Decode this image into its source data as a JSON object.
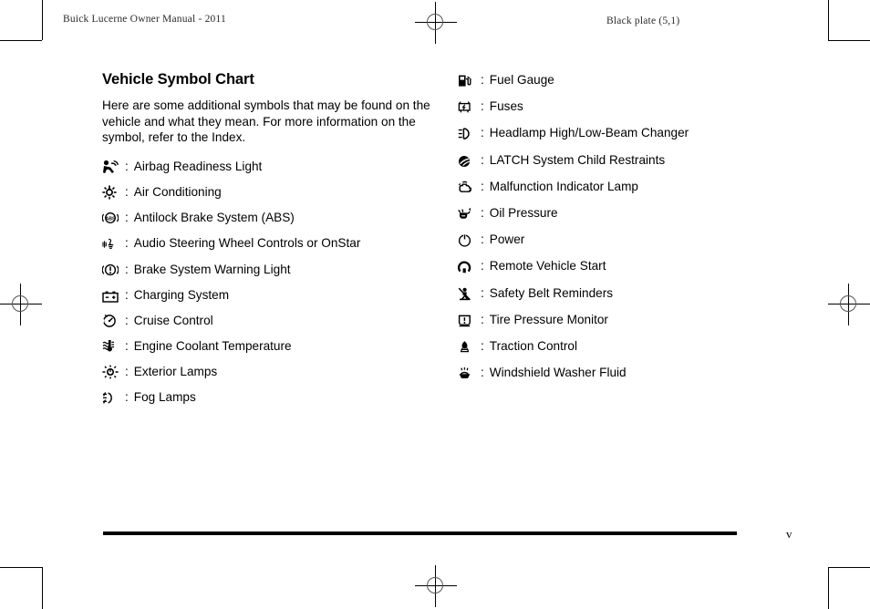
{
  "header": {
    "left_text": "Buick Lucerne Owner Manual - 2011",
    "right_text": "Black plate (5,1)"
  },
  "main": {
    "title": "Vehicle Symbol Chart",
    "intro": "Here are some additional symbols that may be found on the vehicle and what they mean. For more information on the symbol, refer to the Index.",
    "separator": ":",
    "left_column": [
      {
        "icon": "airbag-readiness-icon",
        "label": "Airbag Readiness Light"
      },
      {
        "icon": "air-conditioning-icon",
        "label": "Air Conditioning"
      },
      {
        "icon": "abs-icon",
        "label": "Antilock Brake System (ABS)"
      },
      {
        "icon": "audio-steering-icon",
        "label": "Audio Steering Wheel Controls or OnStar",
        "superscript": "®"
      },
      {
        "icon": "brake-warning-icon",
        "label": "Brake System Warning Light"
      },
      {
        "icon": "charging-system-icon",
        "label": "Charging System"
      },
      {
        "icon": "cruise-control-icon",
        "label": "Cruise Control"
      },
      {
        "icon": "engine-coolant-temp-icon",
        "label": "Engine Coolant Temperature"
      },
      {
        "icon": "exterior-lamps-icon",
        "label": "Exterior Lamps"
      },
      {
        "icon": "fog-lamps-icon",
        "label": "Fog Lamps"
      }
    ],
    "right_column": [
      {
        "icon": "fuel-gauge-icon",
        "label": "Fuel Gauge"
      },
      {
        "icon": "fuses-icon",
        "label": "Fuses"
      },
      {
        "icon": "headlamp-beam-icon",
        "label": "Headlamp High/Low-Beam Changer"
      },
      {
        "icon": "latch-child-restraint-icon",
        "label": "LATCH System Child Restraints"
      },
      {
        "icon": "malfunction-indicator-icon",
        "label": "Malfunction Indicator Lamp"
      },
      {
        "icon": "oil-pressure-icon",
        "label": "Oil Pressure"
      },
      {
        "icon": "power-icon",
        "label": "Power"
      },
      {
        "icon": "remote-vehicle-start-icon",
        "label": "Remote Vehicle Start"
      },
      {
        "icon": "safety-belt-icon",
        "label": "Safety Belt Reminders"
      },
      {
        "icon": "tire-pressure-icon",
        "label": "Tire Pressure Monitor"
      },
      {
        "icon": "traction-control-icon",
        "label": "Traction Control"
      },
      {
        "icon": "windshield-washer-icon",
        "label": "Windshield Washer Fluid"
      }
    ]
  },
  "footer": {
    "page_number": "v"
  },
  "colors": {
    "text": "#000000",
    "rule": "#000000",
    "runhead": "#2b2b2b"
  }
}
